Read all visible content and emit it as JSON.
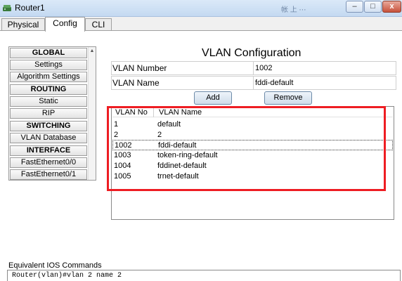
{
  "window": {
    "title": "Router1",
    "ghost_title": "帐 上 ⋯",
    "controls": {
      "minimize": "–",
      "maximize": "□",
      "close": "x"
    }
  },
  "tabs": [
    {
      "label": "Physical"
    },
    {
      "label": "Config",
      "active": true
    },
    {
      "label": "CLI"
    }
  ],
  "sidebar": {
    "items": [
      {
        "label": "GLOBAL",
        "header": true
      },
      {
        "label": "Settings"
      },
      {
        "label": "Algorithm Settings"
      },
      {
        "label": "ROUTING",
        "header": true
      },
      {
        "label": "Static"
      },
      {
        "label": "RIP"
      },
      {
        "label": "SWITCHING",
        "header": true
      },
      {
        "label": "VLAN Database"
      },
      {
        "label": "INTERFACE",
        "header": true
      },
      {
        "label": "FastEthernet0/0"
      },
      {
        "label": "FastEthernet0/1"
      }
    ]
  },
  "main": {
    "title": "VLAN Configuration",
    "vlan_number_label": "VLAN Number",
    "vlan_number_value": "1002",
    "vlan_name_label": "VLAN Name",
    "vlan_name_value": "fddi-default",
    "add_label": "Add",
    "remove_label": "Remove"
  },
  "vlan_table": {
    "columns": [
      "VLAN No",
      "VLAN Name"
    ],
    "rows": [
      {
        "no": "1",
        "name": "default"
      },
      {
        "no": "2",
        "name": "2"
      },
      {
        "no": "1002",
        "name": "fddi-default",
        "selected": true
      },
      {
        "no": "1003",
        "name": "token-ring-default"
      },
      {
        "no": "1004",
        "name": "fddinet-default"
      },
      {
        "no": "1005",
        "name": "trnet-default"
      }
    ]
  },
  "ios": {
    "label": "Equivalent IOS Commands",
    "command": "Router(vlan)#vlan 2 name 2"
  },
  "colors": {
    "highlight": "#ee1d23",
    "titlebar": "#c4d9f1"
  }
}
